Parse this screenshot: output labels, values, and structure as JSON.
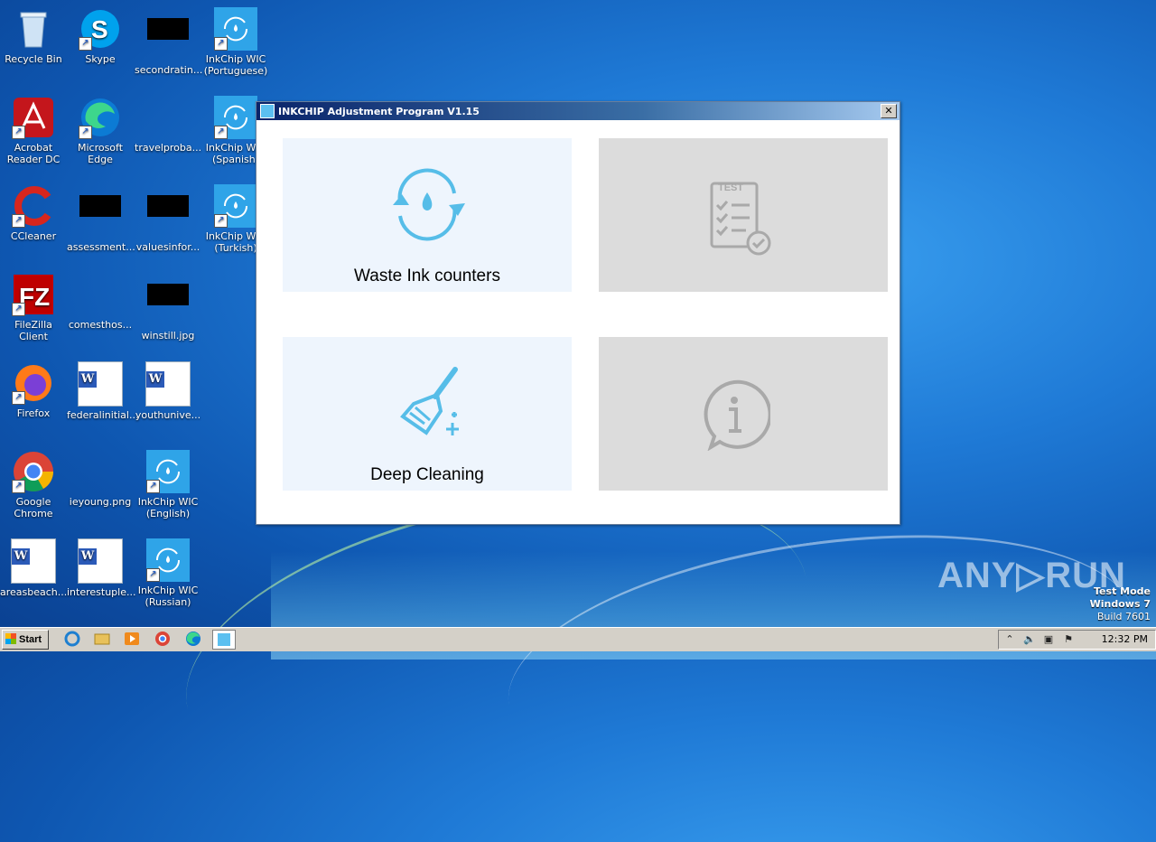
{
  "desktop": {
    "icons": [
      {
        "label": "Recycle Bin"
      },
      {
        "label": "Skype"
      },
      {
        "label": "secondratin..."
      },
      {
        "label": "InkChip WIC (Portuguese)"
      },
      {
        "label": "Acrobat Reader DC"
      },
      {
        "label": "Microsoft Edge"
      },
      {
        "label": "travelproba..."
      },
      {
        "label": "InkChip WIC (Spanish)"
      },
      {
        "label": "CCleaner"
      },
      {
        "label": "assessment..."
      },
      {
        "label": "valuesinfor..."
      },
      {
        "label": "InkChip WIC (Turkish)"
      },
      {
        "label": "FileZilla Client"
      },
      {
        "label": "comesthos..."
      },
      {
        "label": "winstill.jpg"
      },
      {
        "label": "Firefox"
      },
      {
        "label": "federalinitial..."
      },
      {
        "label": "youthunive..."
      },
      {
        "label": "Google Chrome"
      },
      {
        "label": "ieyoung.png"
      },
      {
        "label": "InkChip WIC (English)"
      },
      {
        "label": "areasbeach..."
      },
      {
        "label": "interestuple..."
      },
      {
        "label": "InkChip WIC (Russian)"
      }
    ]
  },
  "window": {
    "title": "INKCHIP Adjustment Program V1.15",
    "close_label": "✕",
    "tiles": [
      {
        "label": "Waste Ink counters",
        "icon": "refresh-drop-icon"
      },
      {
        "label": "",
        "icon": "test-clipboard-icon"
      },
      {
        "label": "Deep Cleaning",
        "icon": "brush-icon"
      },
      {
        "label": "",
        "icon": "info-icon"
      }
    ]
  },
  "watermark": {
    "text": "ANY▷RUN"
  },
  "testmode": {
    "line1": "Test Mode",
    "line2": "Windows 7",
    "line3": "Build 7601"
  },
  "taskbar": {
    "start_label": "Start",
    "clock": "12:32 PM"
  },
  "colors": {
    "accent": "#56bde8",
    "disabled": "#a9a9a9",
    "tile_active": "#eef5fd",
    "tile_disabled": "#dcdcdc"
  }
}
